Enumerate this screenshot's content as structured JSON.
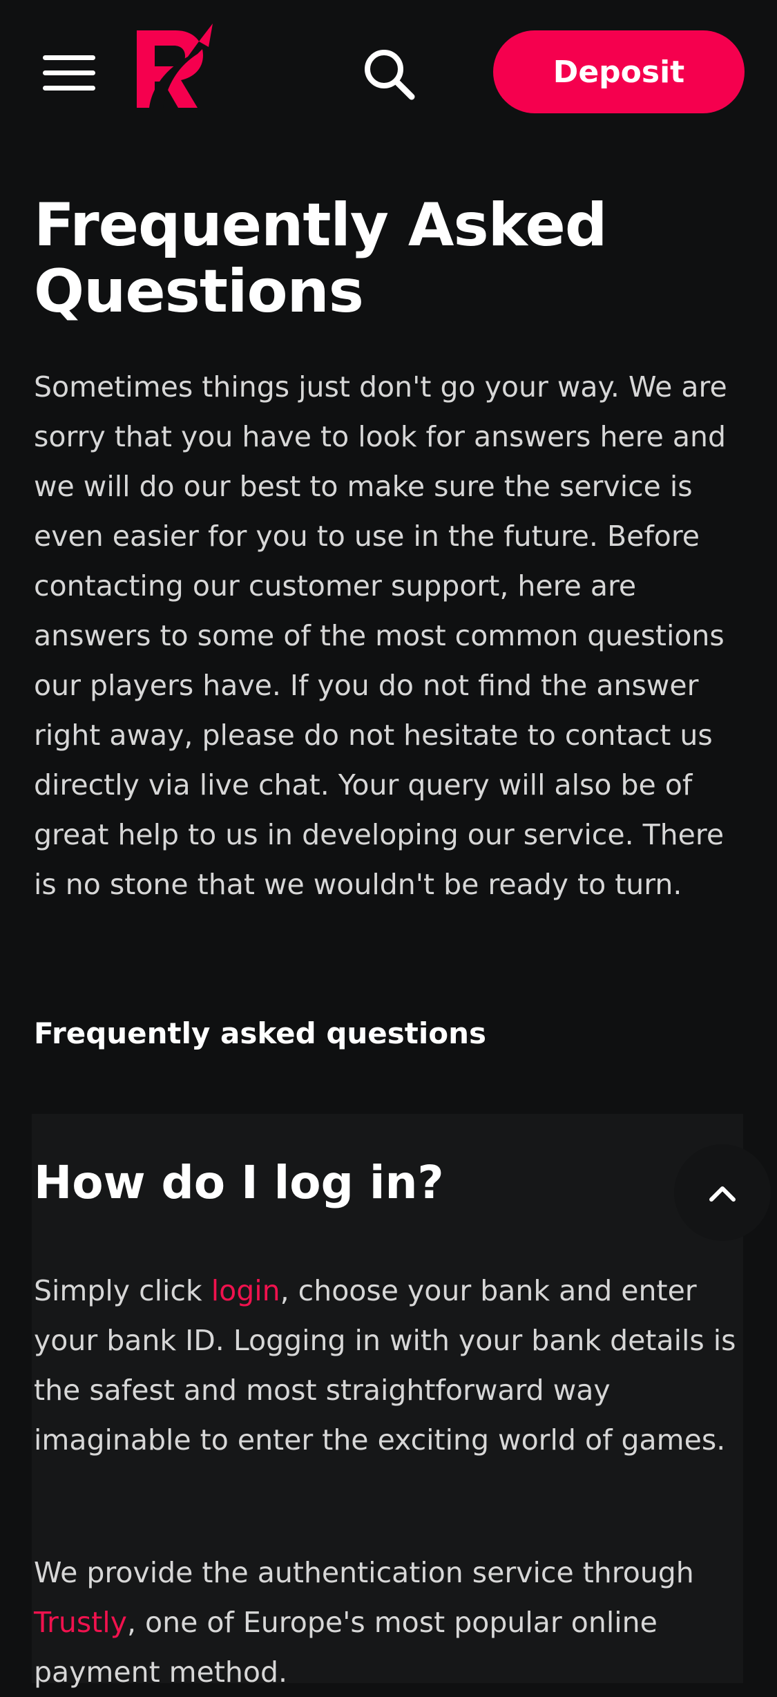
{
  "header": {
    "menu_icon": "hamburger-menu-icon",
    "logo_icon": "brand-logo-icon",
    "search_icon": "search-icon",
    "deposit_label": "Deposit"
  },
  "colors": {
    "background": "#0f1011",
    "card": "#161718",
    "accent": "#f5004e",
    "link": "#f0124e",
    "body_text": "#d7d7d7"
  },
  "page": {
    "title_line1": "Frequently Asked",
    "title_line2": "Questions",
    "intro": "Sometimes things just don't go your way. We are sorry that you have to look for answers here and we will do our best to make sure the service is even easier for you to use in the future. Before contacting our customer support, here are answers to some of the most common questions our players have. If you do not find the answer right away, please do not hesitate to contact us directly via live chat. Your query will also be of great help to us in developing our service. There is no stone that we wouldn't be ready to turn.",
    "section_title": "Frequently asked questions"
  },
  "faq": {
    "question": "How do I log in?",
    "toggle_icon": "chevron-up-icon",
    "answer1_before": "Simply click ",
    "answer1_link": "login",
    "answer1_after": ", choose your bank and enter your bank ID. Logging in with your bank details is the safest and most straightforward way imaginable to enter the exciting world of games.",
    "answer2_before": "We provide the authentication service through ",
    "answer2_link": "Trustly",
    "answer2_after": ", one of Europe's most popular online payment method."
  }
}
